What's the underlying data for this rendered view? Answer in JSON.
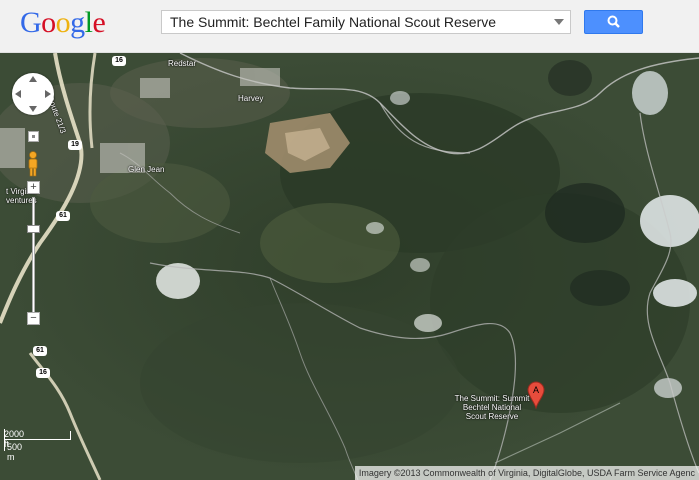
{
  "header": {
    "logo": {
      "letters": [
        {
          "char": "G",
          "color": "#3369e8"
        },
        {
          "char": "o",
          "color": "#d50f25"
        },
        {
          "char": "o",
          "color": "#eeb211"
        },
        {
          "char": "g",
          "color": "#3369e8"
        },
        {
          "char": "l",
          "color": "#009925"
        },
        {
          "char": "e",
          "color": "#d50f25"
        }
      ]
    },
    "search": {
      "value": "The Summit: Bechtel Family National Scout Reserve"
    },
    "search_button_icon": "search-icon"
  },
  "map": {
    "view": "satellite",
    "labels": {
      "redstar": "Redstar",
      "harvey": "Harvey",
      "glen_jean": "Glen Jean",
      "co_route": "Co Route 21/3",
      "west_virginia_adventures_1": "t Virginia",
      "west_virginia_adventures_2": "ventures"
    },
    "routes": {
      "r16_top": "16",
      "r19": "19",
      "r61_top": "61",
      "r61_bottom": "61",
      "r16_bottom": "16"
    },
    "place": {
      "marker_letter": "A",
      "name_line1": "The Summit: Summit",
      "name_line2": "Bechtel National",
      "name_line3": "Scout Reserve",
      "marker_color": "#e74c3c"
    },
    "controls": {
      "zoom_in": "+",
      "zoom_out": "−"
    },
    "scale": {
      "imperial": "2000 ft",
      "metric": "500 m"
    },
    "copyright": "Imagery ©2013 Commonwealth of Virginia, DigitalGlobe, USDA Farm Service Agenc"
  }
}
